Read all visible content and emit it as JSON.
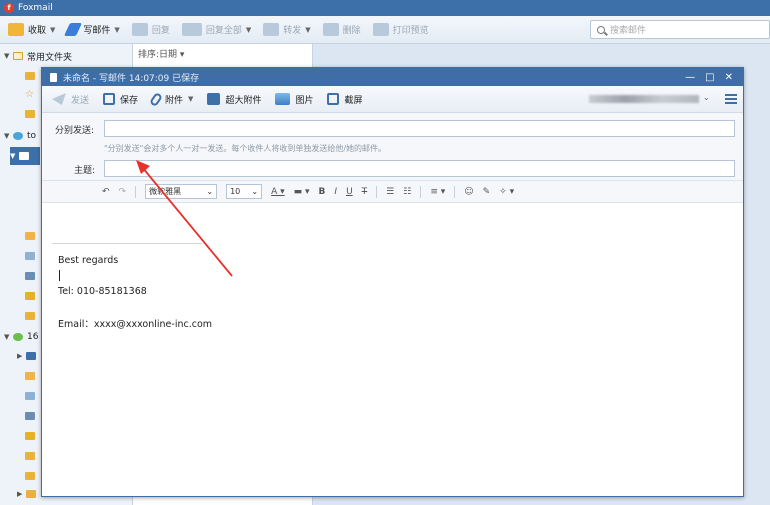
{
  "app": {
    "title": "Foxmail"
  },
  "toolbar": {
    "receive": "收取",
    "compose": "写邮件",
    "reply": "回复",
    "reply_all": "回复全部",
    "forward": "转发",
    "delete": "删除",
    "print_preview": "打印预览",
    "search_placeholder": "搜索邮件"
  },
  "sidebar": {
    "common_folders": "常用文件夹",
    "account_1_prefix": "to",
    "account_2_prefix": "16"
  },
  "maillist": {
    "sort_label": "排序:日期"
  },
  "compose_window": {
    "title": "未命名 - 写邮件  14:07:09 已保存",
    "toolbar": {
      "send": "发送",
      "save": "保存",
      "attachment": "附件",
      "large_attachment": "超大附件",
      "image": "图片",
      "screenshot": "截屏"
    },
    "separate_send_label": "分别发送:",
    "separate_send_hint": "\"分别发送\"会对多个人一对一发送。每个收件人将收到单独发送给他/她的邮件。",
    "subject_label": "主题:",
    "format_bar": {
      "font_name": "微软雅黑",
      "font_size": "10"
    },
    "signature": {
      "line1": "Best regards",
      "tel": "Tel: 010-85181368",
      "email": "Email：xxxx@xxxonline-inc.com"
    }
  },
  "colors": {
    "titlebar": "#3d6fa8",
    "compose_titlebar": "#3f6ea6",
    "annotation_arrow": "#e8312b"
  }
}
